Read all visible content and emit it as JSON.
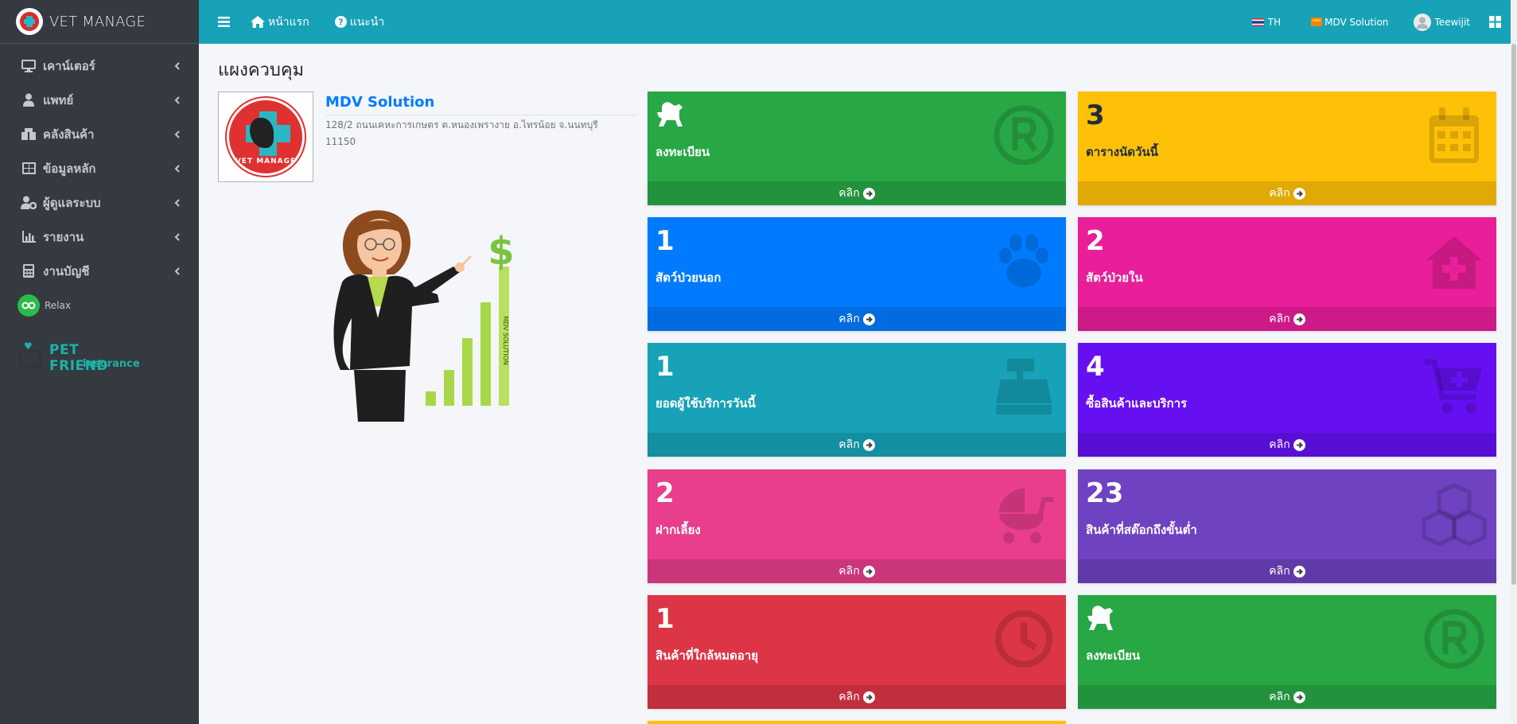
{
  "brand": {
    "title": "VET MANAGE"
  },
  "sidebar": {
    "items": [
      {
        "label": "เคาน์เตอร์",
        "icon": "monitor-icon"
      },
      {
        "label": "แพทย์",
        "icon": "doctor-icon"
      },
      {
        "label": "คลังสินค้า",
        "icon": "boxes-icon"
      },
      {
        "label": "ข้อมูลหลัก",
        "icon": "table-icon"
      },
      {
        "label": "ผู้ดูแลระบบ",
        "icon": "user-gear-icon"
      },
      {
        "label": "รายงาน",
        "icon": "bar-chart-icon"
      },
      {
        "label": "งานบัญชี",
        "icon": "calculator-icon"
      }
    ],
    "relax": {
      "label": "Relax"
    },
    "petfriend": {
      "title": "PET FRIEND",
      "subtitle": "insurance"
    }
  },
  "topbar": {
    "home": "หน้าแรก",
    "help": "แนะนำ",
    "language": "TH",
    "company": "MDV Solution",
    "user": "Teewijit"
  },
  "page": {
    "title": "แผงควบคุม"
  },
  "company": {
    "name": "MDV Solution",
    "address_line1": "128/2 ถนนเคหะการเกษตร ต.หนองเพรางาย อ.ไทรน้อย จ.นนทบุรี",
    "address_line2": "11150",
    "logo_text": "VET MANAGE",
    "illustration_text": "MDV SOLUTION"
  },
  "cards": [
    {
      "value": "",
      "label": "ลงทะเบียน",
      "footer": "คลิก",
      "color": "#28a745",
      "icon": "registered-icon"
    },
    {
      "value": "3",
      "label": "ตารางนัดวันนี้",
      "footer": "คลิก",
      "color": "#ffc107",
      "icon": "calendar-icon"
    },
    {
      "value": "1",
      "label": "สัตว์ป่วยนอก",
      "footer": "คลิก",
      "color": "#007bff",
      "icon": "paw-icon"
    },
    {
      "value": "2",
      "label": "สัตว์ป่วยใน",
      "footer": "คลิก",
      "color": "#e91e99",
      "icon": "hospital-icon"
    },
    {
      "value": "1",
      "label": "ยอดผู้ใช้บริการวันนี้",
      "footer": "คลิก",
      "color": "#17a2b8",
      "icon": "cash-register-icon"
    },
    {
      "value": "4",
      "label": "ซื้อสินค้าและบริการ",
      "footer": "คลิก",
      "color": "#6610f2",
      "icon": "cart-plus-icon"
    },
    {
      "value": "2",
      "label": "ฝากเลี้ยง",
      "footer": "คลิก",
      "color": "#e83e8c",
      "icon": "stroller-icon"
    },
    {
      "value": "23",
      "label": "สินค้าที่สต๊อกถึงขั้นต่ำ",
      "footer": "คลิก",
      "color": "#6f42c1",
      "icon": "cubes-icon"
    },
    {
      "value": "1",
      "label": "สินค้าที่ใกล้หมดอายุ",
      "footer": "คลิก",
      "color": "#dc3545",
      "icon": "clock-icon"
    },
    {
      "value": "",
      "label": "ลงทะเบียน",
      "footer": "คลิก",
      "color": "#28a745",
      "icon": "registered-icon"
    }
  ]
}
